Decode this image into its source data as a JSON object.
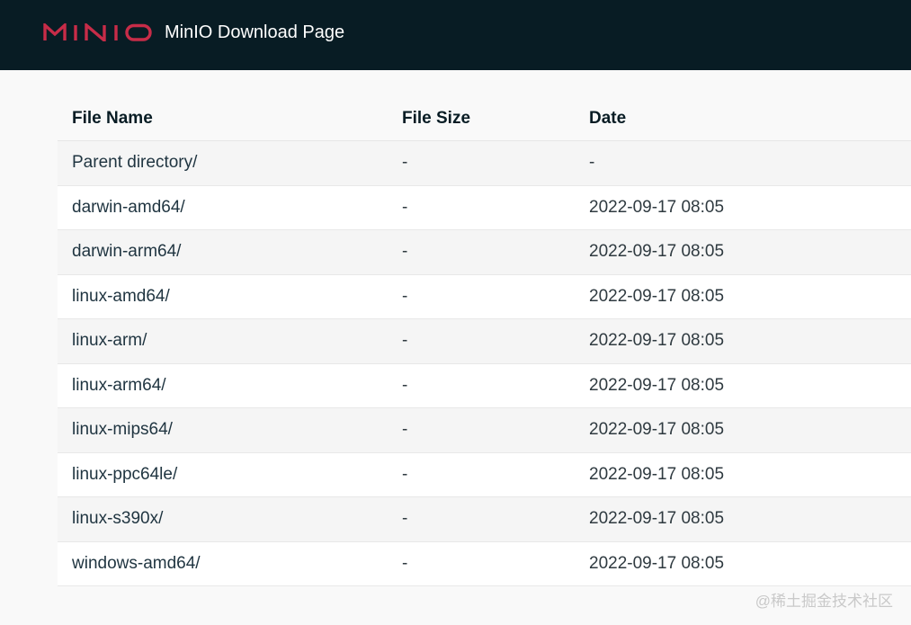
{
  "header": {
    "logo_text": "MINIO",
    "title": "MinIO Download Page",
    "background": "#081c24",
    "logo_color": "#c72c48"
  },
  "table": {
    "columns": [
      "File Name",
      "File Size",
      "Date"
    ],
    "rows": [
      {
        "name": "Parent directory/",
        "size": "-",
        "date": "-"
      },
      {
        "name": "darwin-amd64/",
        "size": "-",
        "date": "2022-09-17 08:05"
      },
      {
        "name": "darwin-arm64/",
        "size": "-",
        "date": "2022-09-17 08:05"
      },
      {
        "name": "linux-amd64/",
        "size": "-",
        "date": "2022-09-17 08:05"
      },
      {
        "name": "linux-arm/",
        "size": "-",
        "date": "2022-09-17 08:05"
      },
      {
        "name": "linux-arm64/",
        "size": "-",
        "date": "2022-09-17 08:05"
      },
      {
        "name": "linux-mips64/",
        "size": "-",
        "date": "2022-09-17 08:05"
      },
      {
        "name": "linux-ppc64le/",
        "size": "-",
        "date": "2022-09-17 08:05"
      },
      {
        "name": "linux-s390x/",
        "size": "-",
        "date": "2022-09-17 08:05"
      },
      {
        "name": "windows-amd64/",
        "size": "-",
        "date": "2022-09-17 08:05"
      }
    ]
  },
  "watermark": "@稀土掘金技术社区"
}
